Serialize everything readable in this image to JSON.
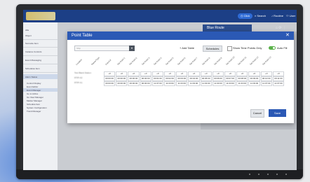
{
  "colors": {
    "accent": "#2b59b5",
    "topbar": "#1c3f86",
    "toggle_on": "#5ab24a"
  },
  "topbar": {
    "buttons": [
      {
        "label": "Click",
        "icon": "clock-icon"
      },
      {
        "label": "Search",
        "icon": "search-icon"
      },
      {
        "label": "Routine",
        "icon": "bell-icon"
      },
      {
        "label": "User",
        "icon": "user-icon"
      }
    ]
  },
  "side_panel": {
    "title": "Blue Route",
    "icons": [
      "home-icon",
      "refresh-icon",
      "more-icon"
    ]
  },
  "sidebar": {
    "items": [
      "Alla",
      "Object",
      "Sonnette Item",
      "Instance Controls",
      "Event Messaging",
      "Schedules Item",
      "Alarm Status"
    ],
    "sub_items": [
      "Control Display",
      "Event Editor",
      "Event Manager",
      "Go to ActIce",
      "Go View Manager",
      "Marker Manager",
      "Schedule Item",
      "System Configuration",
      "Trend Manager"
    ]
  },
  "dialog": {
    "title": "Point Table",
    "select_placeholder": "Ship",
    "add_table_label": "+ Add Table",
    "schedules_label": "Schedules",
    "show_time_points_label": "Show Time Points Only",
    "auto_fill_label": "Auto Fill",
    "auto_fill_on": true,
    "cancel_label": "Cancel",
    "save_label": "Save",
    "columns": [
      "Location",
      "Name/Type",
      "Auto/Ld",
      "Set Point 1",
      "Set Point 2",
      "Set Point 3",
      "Set Point 4",
      "Set Point 5",
      "Set Point 6",
      "Set Point 7",
      "Set Point 8",
      "Set Point 9",
      "Set Point 10",
      "Set Point 11",
      "Set Point 12",
      "Set Point 13"
    ],
    "rows": [
      {
        "label": "Test Blank Station",
        "cells": [
          "+0",
          "+0",
          "+0",
          "+0",
          "+0",
          "+0",
          "+0",
          "+0",
          "+0",
          "+0",
          "+0",
          "+0",
          "+0",
          "+0",
          "+0"
        ]
      },
      {
        "label": "RTIP-A2",
        "cells": [
          "00:00:00",
          "00:00:00",
          "00:00:00",
          "00:00:00",
          "00:01:00",
          "00:02:00",
          "00:03:00",
          "00:04:00",
          "00:05:00",
          "00:06:00",
          "00:07:00",
          "00:08:00",
          "00:09:00",
          "00:10:00",
          "00:11:00"
        ]
      },
      {
        "label": "RTIP-A1",
        "cells": [
          "00:00:00",
          "00:00:00",
          "00:00:00",
          "00:00:00",
          "11:07:00",
          "11:03:00",
          "11:03:00",
          "11:03:00",
          "11:03:00",
          "11:03:00",
          "11:03:00",
          "11:03:00",
          "11:03:00",
          "11:07:00",
          "11:07:00"
        ]
      }
    ]
  }
}
